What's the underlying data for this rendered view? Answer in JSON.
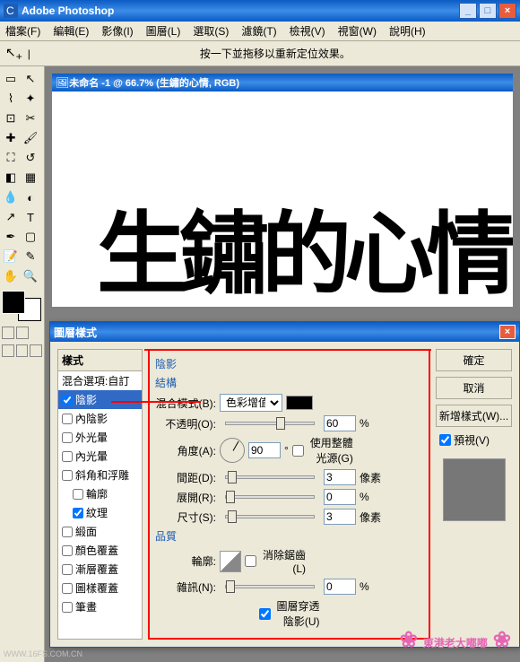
{
  "app": {
    "title": "Adobe Photoshop"
  },
  "menu": {
    "file": "檔案(F)",
    "edit": "編輯(E)",
    "image": "影像(I)",
    "layer": "圖層(L)",
    "select": "選取(S)",
    "filter": "濾鏡(T)",
    "view": "檢視(V)",
    "window": "視窗(W)",
    "help": "說明(H)"
  },
  "toolbar": {
    "hint": "按一下並拖移以重新定位效果。"
  },
  "doc": {
    "title": "未命名 -1 @ 66.7% (生鏽的心情, RGB)",
    "canvas_text": "生鏽的心情"
  },
  "dialog": {
    "title": "圖層樣式",
    "styles_hdr": "樣式",
    "blend_opts": "混合選項:自訂",
    "list": [
      {
        "label": "陰影",
        "checked": true,
        "selected": true
      },
      {
        "label": "內陰影",
        "checked": false
      },
      {
        "label": "外光暈",
        "checked": false
      },
      {
        "label": "內光暈",
        "checked": false
      },
      {
        "label": "斜角和浮雕",
        "checked": false
      },
      {
        "label": "輪廓",
        "checked": false,
        "indent": true
      },
      {
        "label": "紋理",
        "checked": true,
        "indent": true
      },
      {
        "label": "緞面",
        "checked": false
      },
      {
        "label": "顏色覆蓋",
        "checked": false
      },
      {
        "label": "漸層覆蓋",
        "checked": false
      },
      {
        "label": "圖樣覆蓋",
        "checked": false
      },
      {
        "label": "筆畫",
        "checked": false
      }
    ],
    "section": "陰影",
    "structure": "結構",
    "blend_mode_label": "混合模式(B):",
    "blend_mode_value": "色彩增值",
    "opacity_label": "不透明(O):",
    "opacity_value": "60",
    "pct": "%",
    "angle_label": "角度(A):",
    "angle_value": "90",
    "deg": "°",
    "global_light": "使用整體光源(G)",
    "distance_label": "間距(D):",
    "distance_value": "3",
    "px": "像素",
    "spread_label": "展開(R):",
    "spread_value": "0",
    "size_label": "尺寸(S):",
    "size_value": "3",
    "quality": "品質",
    "contour_label": "輪廓:",
    "antialias": "消除鋸齒(L)",
    "noise_label": "雜訊(N):",
    "noise_value": "0",
    "knockout": "圖層穿透陰影(U)",
    "ok": "確定",
    "cancel": "取消",
    "new_style": "新增樣式(W)...",
    "preview": "預視(V)"
  },
  "deco": "東港老大嘟嘟",
  "watermark": "WWW.16FS.COM.CN"
}
